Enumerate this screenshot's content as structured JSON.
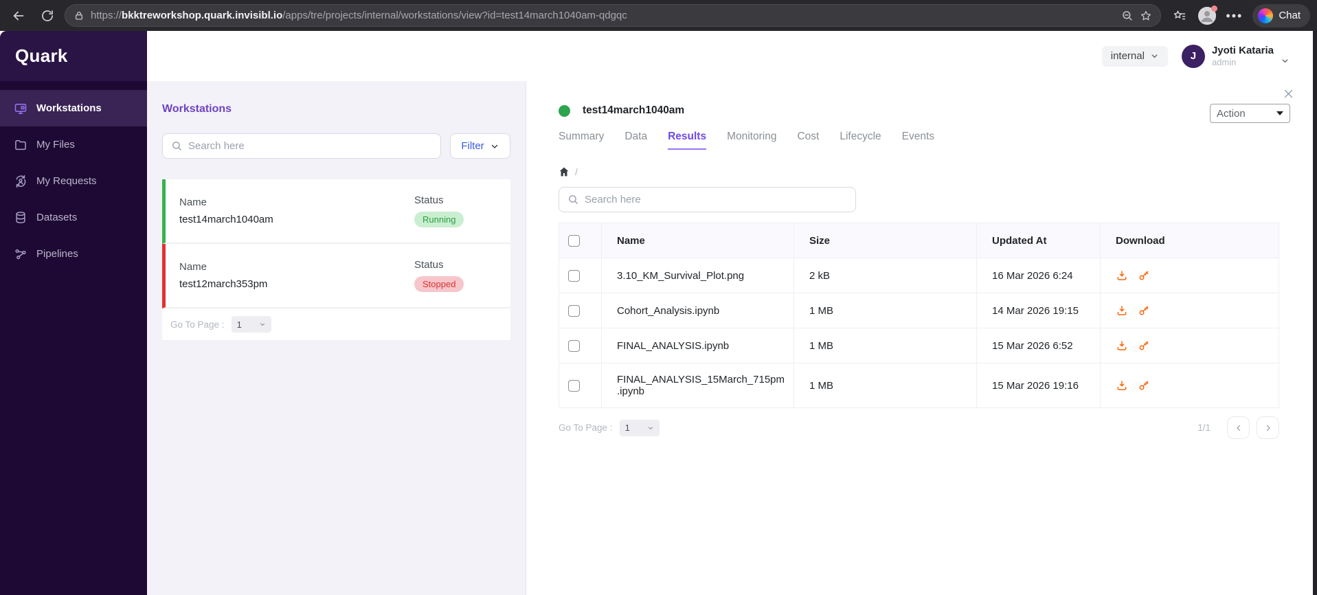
{
  "browser": {
    "url_scheme": "https://",
    "url_domain": "bkktreworkshop.quark.invisibl.io",
    "url_path": "/apps/tre/projects/internal/workstations/view?id=test14march1040am-qdgqc",
    "chat_label": "Chat"
  },
  "sidebar": {
    "logo": "Quark",
    "items": [
      {
        "label": "Workstations",
        "icon": "monitor-icon",
        "active": true
      },
      {
        "label": "My Files",
        "icon": "folder-icon",
        "active": false
      },
      {
        "label": "My Requests",
        "icon": "user-sync-icon",
        "active": false
      },
      {
        "label": "Datasets",
        "icon": "database-icon",
        "active": false
      },
      {
        "label": "Pipelines",
        "icon": "nodes-icon",
        "active": false
      }
    ]
  },
  "header": {
    "project_selector": "internal",
    "user_initial": "J",
    "user_name": "Jyoti Kataria",
    "user_role": "admin"
  },
  "panel": {
    "title": "Workstations",
    "search_placeholder": "Search here",
    "filter_label": "Filter",
    "cards": [
      {
        "name_label": "Name",
        "name": "test14march1040am",
        "status_label": "Status",
        "status": "Running",
        "status_color": "#2f9e44"
      },
      {
        "name_label": "Name",
        "name": "test12march353pm",
        "status_label": "Status",
        "status": "Stopped",
        "status_color": "#e03131"
      }
    ],
    "pagination": {
      "label": "Go To Page :",
      "page": "1"
    }
  },
  "detail": {
    "title": "test14march1040am",
    "status": "running",
    "action_label": "Action",
    "tabs": [
      {
        "label": "Summary",
        "active": false
      },
      {
        "label": "Data",
        "active": false
      },
      {
        "label": "Results",
        "active": true
      },
      {
        "label": "Monitoring",
        "active": false
      },
      {
        "label": "Cost",
        "active": false
      },
      {
        "label": "Lifecycle",
        "active": false
      },
      {
        "label": "Events",
        "active": false
      }
    ],
    "breadcrumb_separator": "/",
    "search_placeholder": "Search here",
    "table": {
      "columns": [
        "Name",
        "Size",
        "Updated At",
        "Download"
      ],
      "rows": [
        {
          "name": "3.10_KM_Survival_Plot.png",
          "size": "2 kB",
          "updated": "16 Mar 2026 6:24"
        },
        {
          "name": "Cohort_Analysis.ipynb",
          "size": "1 MB",
          "updated": "14 Mar 2026 19:15"
        },
        {
          "name": "FINAL_ANALYSIS.ipynb",
          "size": "1 MB",
          "updated": "15 Mar 2026 6:52"
        },
        {
          "name": "FINAL_ANALYSIS_15March_715pm.ipynb",
          "size": "1 MB",
          "updated": "15 Mar 2026 19:16"
        }
      ]
    },
    "pagination": {
      "label": "Go To Page :",
      "page": "1",
      "info": "1/1"
    }
  },
  "colors": {
    "accent": "#7048e8",
    "running-green": "#2f9e44",
    "stopped-red": "#e03131",
    "download-orange": "#f76707"
  }
}
